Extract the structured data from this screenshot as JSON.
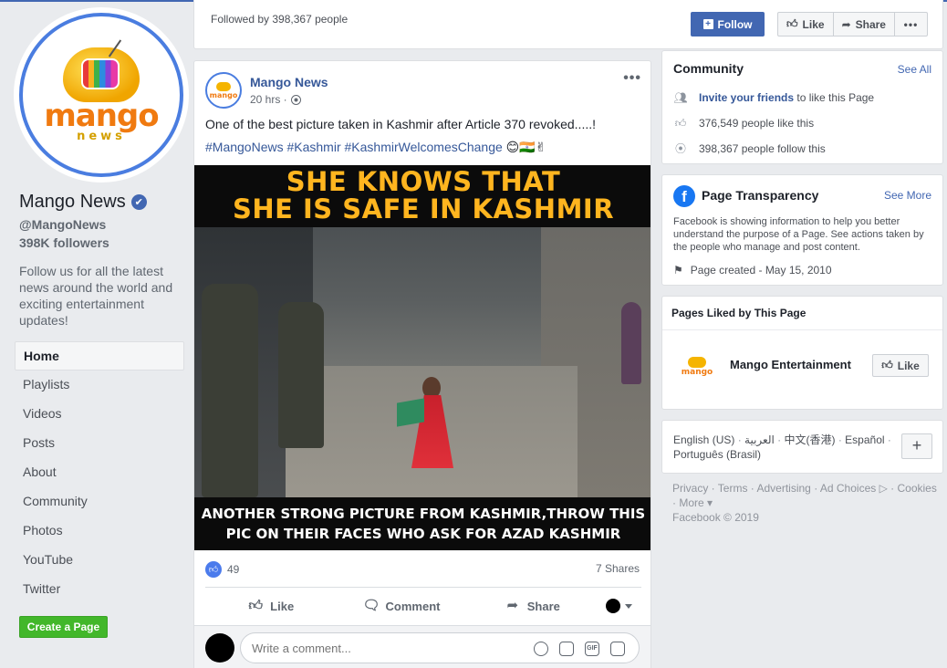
{
  "left": {
    "page_name": "Mango News",
    "verified_icon": "✔",
    "handle": "@MangoNews",
    "followers": "398K followers",
    "about": "Follow us for all the latest news around the world and exciting entertainment updates!",
    "logo_text": "mango",
    "logo_sub": "news",
    "nav": [
      {
        "label": "Home"
      },
      {
        "label": "Playlists"
      },
      {
        "label": "Videos"
      },
      {
        "label": "Posts"
      },
      {
        "label": "About"
      },
      {
        "label": "Community"
      },
      {
        "label": "Photos"
      },
      {
        "label": "YouTube"
      },
      {
        "label": "Twitter"
      }
    ],
    "create_page": "Create a Page"
  },
  "topbar": {
    "followed_by": "Followed by 398,367 people",
    "follow_label": "Follow",
    "like_label": "Like",
    "share_label": "Share",
    "more_label": "•••"
  },
  "post": {
    "author": "Mango News",
    "time": "20 hrs ·",
    "menu": "•••",
    "text": "One of the best picture taken in Kashmir after Article 370 revoked.....!",
    "tags": "#MangoNews #Kashmir #KashmirWelcomesChange",
    "tag_emoji": "😊🇮🇳✌",
    "image": {
      "headline_1": "SHE KNOWS THAT",
      "headline_2": "SHE IS SAFE IN KASHMIR",
      "caption_1": "ANOTHER STRONG PICTURE FROM KASHMIR,THROW THIS",
      "caption_2": "PIC ON THEIR FACES WHO ASK FOR AZAD KASHMIR"
    },
    "like_count": "49",
    "shares": "7 Shares",
    "actions": {
      "like": "Like",
      "comment": "Comment",
      "share": "Share"
    },
    "comment_placeholder": "Write a comment..."
  },
  "community": {
    "title": "Community",
    "see_all": "See All",
    "invite_link": "Invite your friends",
    "invite_rest": "to like this Page",
    "likes": "376,549 people like this",
    "follows": "398,367 people follow this"
  },
  "transparency": {
    "title": "Page Transparency",
    "see_more": "See More",
    "description": "Facebook is showing information to help you better understand the purpose of a Page. See actions taken by the people who manage and post content.",
    "created": "Page created - May 15, 2010"
  },
  "liked_pages": {
    "title": "Pages Liked by This Page",
    "name": "Mango Entertainment",
    "like_label": "Like"
  },
  "languages": {
    "l1": "English (US)",
    "l2": "العربية",
    "l3": "中文(香港)",
    "l4": "Español",
    "l5": "Português (Brasil)",
    "plus": "+"
  },
  "footer": {
    "privacy": "Privacy",
    "terms": "Terms",
    "advertising": "Advertising",
    "adchoices": "Ad Choices",
    "cookies": "Cookies",
    "more": "More",
    "copyright": "Facebook © 2019"
  }
}
